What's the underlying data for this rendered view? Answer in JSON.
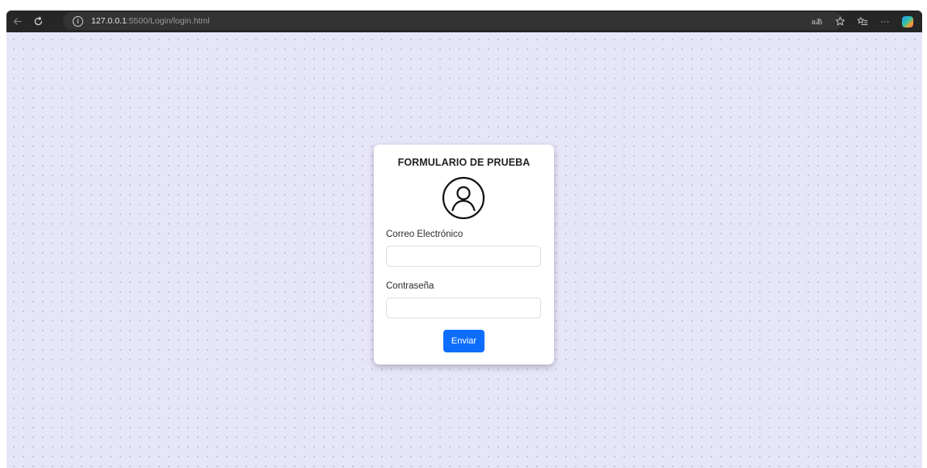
{
  "browser": {
    "url_host": "127.0.0.1",
    "url_path": ":5500/Login/login.html",
    "read_aloud_label": "aあ",
    "more_label": "···",
    "icons": [
      "back-arrow-icon",
      "reload-icon",
      "info-icon",
      "read-aloud-icon",
      "favorite-star-icon",
      "favorites-list-icon",
      "more-icon",
      "copilot-icon"
    ]
  },
  "form": {
    "title": "FORMULARIO DE PRUEBA",
    "avatar_icon": "user-circle-icon",
    "email_label": "Correo Electrónico",
    "email_value": "",
    "email_placeholder": "",
    "password_label": "Contraseña",
    "password_value": "",
    "password_placeholder": "",
    "submit_label": "Enviar"
  },
  "colors": {
    "page_background": "#e7e6f8",
    "dot_color": "#b6b5cc",
    "card_background": "#ffffff",
    "button_primary": "#0d6efd",
    "browser_toolbar": "#262626"
  }
}
